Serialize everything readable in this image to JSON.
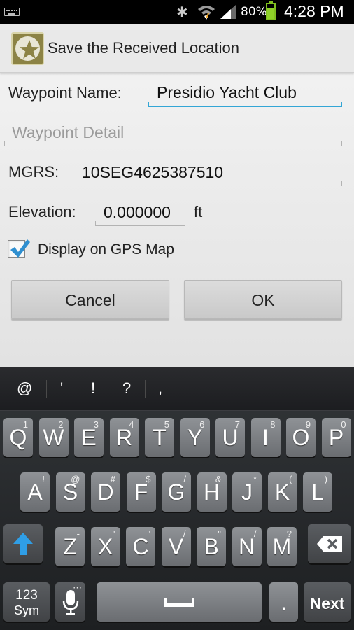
{
  "status_bar": {
    "battery_percent": "80%",
    "battery_level": 0.8,
    "time": "4:28 PM",
    "icons": [
      "keyboard-icon",
      "bluetooth-icon",
      "wifi-icon",
      "signal-icon",
      "battery-icon"
    ],
    "battery_color": "#8fd128"
  },
  "dialog": {
    "title": "Save the Received Location",
    "app_icon": "star-icon",
    "waypoint_name_label": "Waypoint Name:",
    "waypoint_name_value": "Presidio Yacht Club",
    "waypoint_detail_placeholder": "Waypoint Detail",
    "mgrs_label": "MGRS:",
    "mgrs_value": "10SEG4625387510",
    "elevation_label": "Elevation:",
    "elevation_value": "0.000000",
    "elevation_unit": "ft",
    "display_checkbox_label": "Display on GPS Map",
    "display_checked": true,
    "cancel_label": "Cancel",
    "ok_label": "OK",
    "accent_color": "#33a6d6"
  },
  "keyboard": {
    "suggestions": [
      "@",
      "'",
      "!",
      "?",
      ","
    ],
    "row1": [
      {
        "k": "Q",
        "s": "1"
      },
      {
        "k": "W",
        "s": "2"
      },
      {
        "k": "E",
        "s": "3"
      },
      {
        "k": "R",
        "s": "4"
      },
      {
        "k": "T",
        "s": "5"
      },
      {
        "k": "Y",
        "s": "6"
      },
      {
        "k": "U",
        "s": "7"
      },
      {
        "k": "I",
        "s": "8"
      },
      {
        "k": "O",
        "s": "9"
      },
      {
        "k": "P",
        "s": "0"
      }
    ],
    "row2": [
      {
        "k": "A",
        "s": "!"
      },
      {
        "k": "S",
        "s": "@"
      },
      {
        "k": "D",
        "s": "#"
      },
      {
        "k": "F",
        "s": "$"
      },
      {
        "k": "G",
        "s": "/"
      },
      {
        "k": "H",
        "s": "&"
      },
      {
        "k": "J",
        "s": "*"
      },
      {
        "k": "K",
        "s": "("
      },
      {
        "k": "L",
        "s": ")"
      }
    ],
    "row3": [
      {
        "k": "Z",
        "s": "-"
      },
      {
        "k": "X",
        "s": "'"
      },
      {
        "k": "C",
        "s": "\""
      },
      {
        "k": "V",
        "s": "/"
      },
      {
        "k": "B",
        "s": "\""
      },
      {
        "k": "N",
        "s": "/"
      },
      {
        "k": "M",
        "s": "?"
      }
    ],
    "sym_label_top": "123",
    "sym_label_bottom": "Sym",
    "period_label": ".",
    "next_label": "Next",
    "shift_icon": "shift-arrow-icon",
    "backspace_icon": "backspace-icon",
    "mic_icon": "microphone-icon",
    "space_icon": "spacebar-icon",
    "shift_color": "#2f9ee6"
  }
}
